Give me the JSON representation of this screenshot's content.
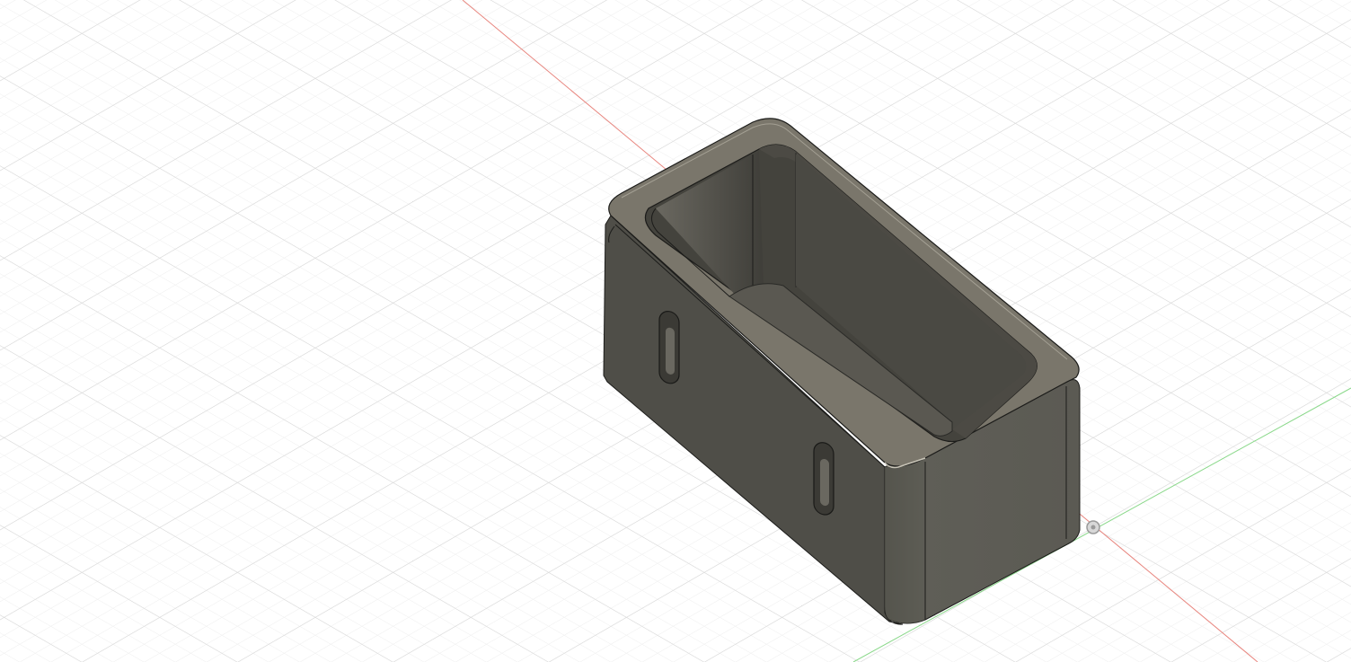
{
  "app": {
    "view": "3d-viewport",
    "projection": "isometric"
  },
  "viewport": {
    "background": "#ffffff",
    "grid_minor_color": "#e9e9e9",
    "grid_major_color": "#d3d3d3",
    "x_axis_color": "#e5736d",
    "y_axis_color": "#7ad47a",
    "origin_marker": "origin-point-icon"
  },
  "model": {
    "name": "open-box-with-slots",
    "body_color": "#5a5a53",
    "top_face_color": "#7a766b",
    "inner_wall_color": "#4e4c45",
    "edge_color": "#1a1a1a",
    "slot_count": 2
  }
}
